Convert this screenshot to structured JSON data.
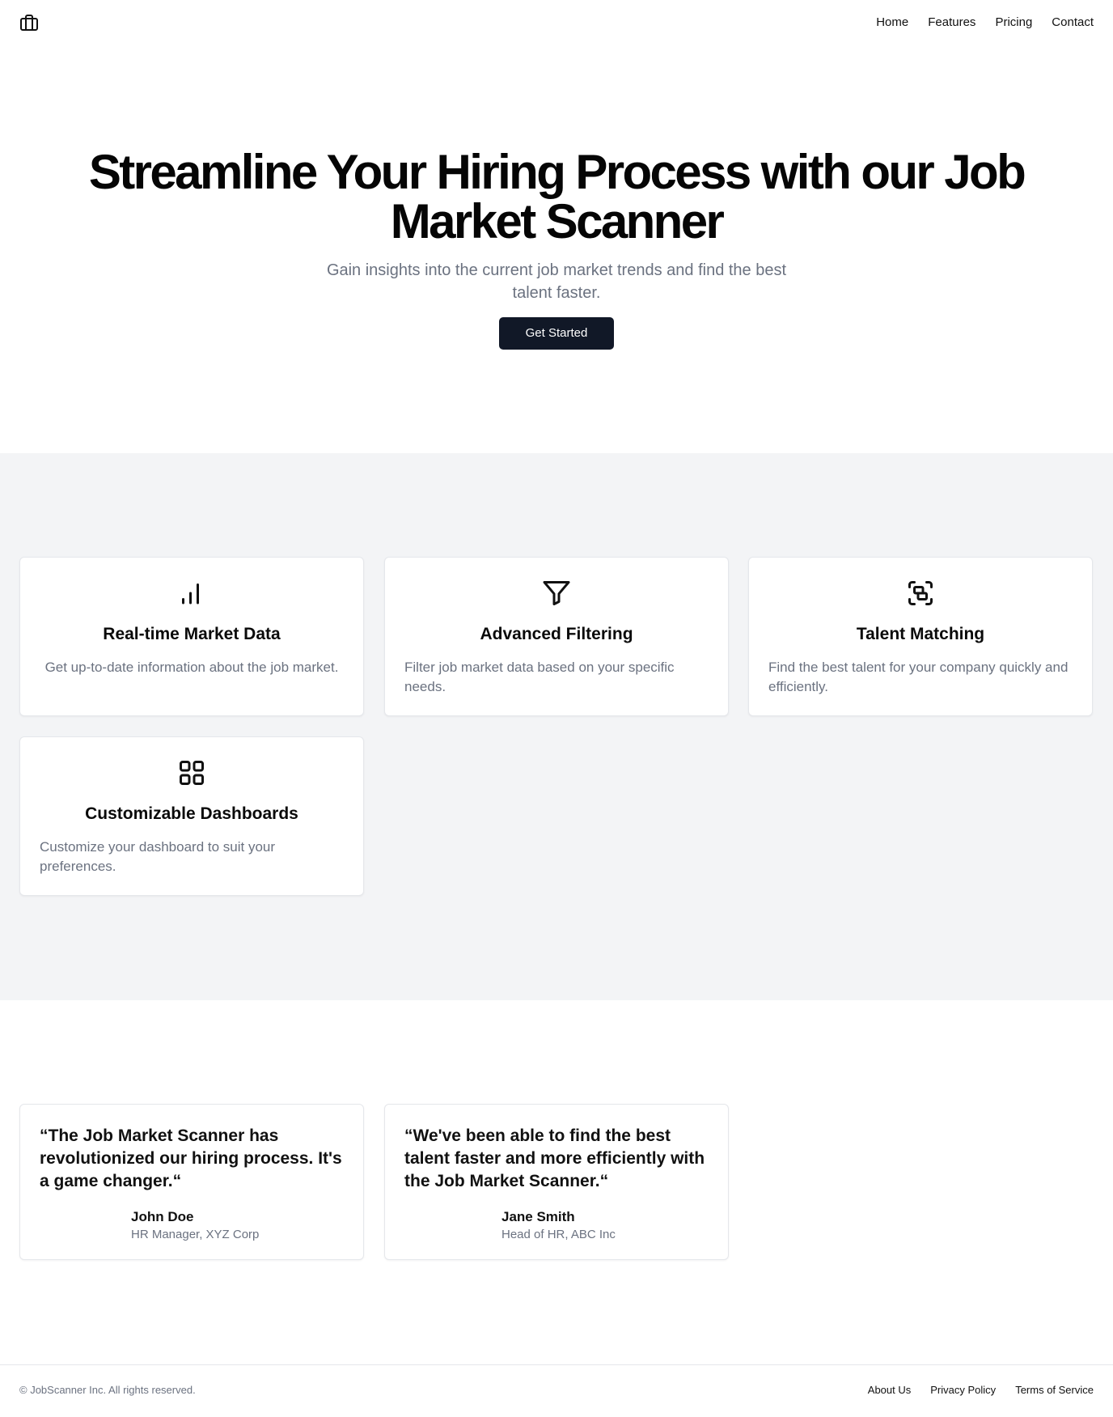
{
  "header": {
    "logo_icon": "briefcase-icon",
    "nav": [
      {
        "label": "Home"
      },
      {
        "label": "Features"
      },
      {
        "label": "Pricing"
      },
      {
        "label": "Contact"
      }
    ]
  },
  "hero": {
    "title": "Streamline Your Hiring Process with our Job Market Scanner",
    "subtitle": "Gain insights into the current job market trends and find the best talent faster.",
    "cta_label": "Get Started"
  },
  "features": [
    {
      "icon": "bar-chart-icon",
      "title": "Real-time Market Data",
      "description": "Get up-to-date information about the job market."
    },
    {
      "icon": "filter-icon",
      "title": "Advanced Filtering",
      "description": "Filter job market data based on your specific needs."
    },
    {
      "icon": "group-select-icon",
      "title": "Talent Matching",
      "description": "Find the best talent for your company quickly and efficiently."
    },
    {
      "icon": "grid-dashboard-icon",
      "title": "Customizable Dashboards",
      "description": "Customize your dashboard to suit your preferences."
    }
  ],
  "testimonials": [
    {
      "quote": "“The Job Market Scanner has revolutionized our hiring process. It's a game changer.“",
      "name": "John Doe",
      "role": "HR Manager, XYZ Corp"
    },
    {
      "quote": "“We've been able to find the best talent faster and more efficiently with the Job Market Scanner.“",
      "name": "Jane Smith",
      "role": "Head of HR, ABC Inc"
    }
  ],
  "footer": {
    "copyright": "© JobScanner Inc. All rights reserved.",
    "links": [
      {
        "label": "About Us"
      },
      {
        "label": "Privacy Policy"
      },
      {
        "label": "Terms of Service"
      }
    ]
  },
  "colors": {
    "primary_button": "#111827",
    "muted_text": "#6b7280",
    "section_bg": "#f3f4f6",
    "border": "#e5e7eb"
  }
}
